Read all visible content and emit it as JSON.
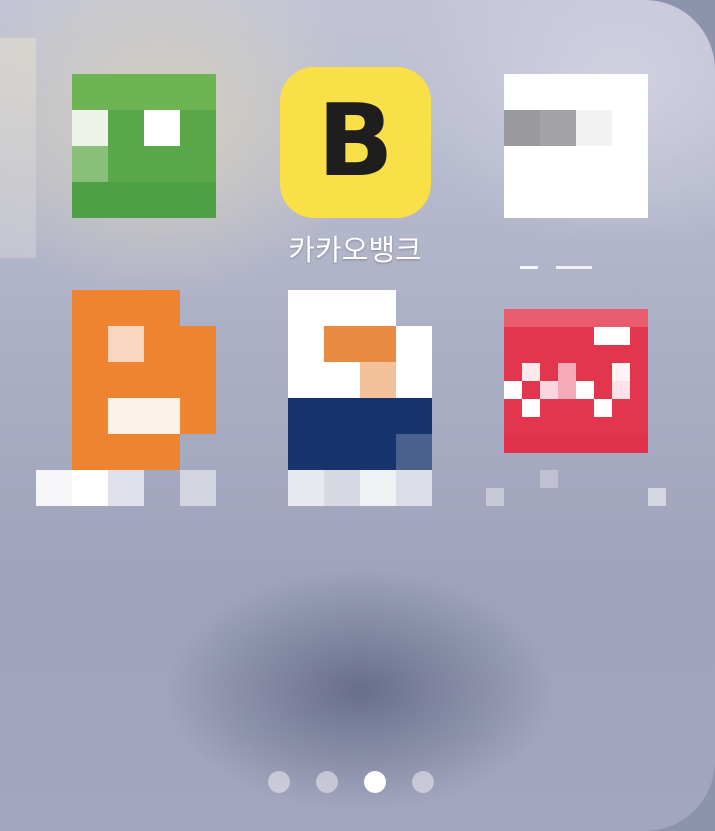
{
  "folder": {
    "apps": [
      {
        "label": "",
        "icon": "green-app-icon",
        "color": "#5aa84a",
        "state": "blurred"
      },
      {
        "label": "카카오뱅크",
        "icon": "kakaobank-icon",
        "glyph": "B",
        "color": "#f9df48"
      },
      {
        "label": "",
        "icon": "white-app-icon",
        "color": "#ffffff",
        "state": "blurred"
      },
      {
        "label": "",
        "icon": "orange-app-icon",
        "color": "#ef8430",
        "state": "blurred"
      },
      {
        "label": "",
        "icon": "person-app-icon",
        "color": "#17346e",
        "state": "blurred"
      },
      {
        "label": "",
        "icon": "red-app-icon",
        "color": "#e2364f",
        "state": "blurred"
      }
    ]
  },
  "page_indicator": {
    "pages": 4,
    "current": 3
  }
}
